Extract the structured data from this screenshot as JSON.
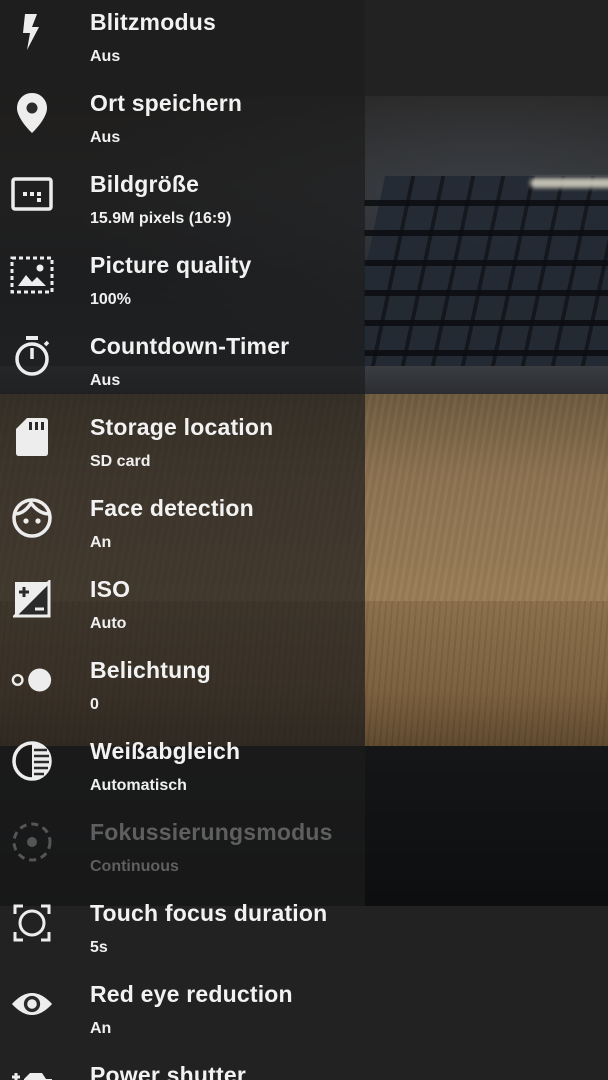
{
  "colors": {
    "panel_bg": "#222222",
    "text_primary": "#f2f2f2",
    "text_disabled": "#5f5f5f"
  },
  "settings": [
    {
      "title": "Blitzmodus",
      "value": "Aus",
      "icon": "flash-icon",
      "enabled": true
    },
    {
      "title": "Ort speichern",
      "value": "Aus",
      "icon": "location-pin-icon",
      "enabled": true
    },
    {
      "title": "Bildgröße",
      "value": "15.9M pixels (16:9)",
      "icon": "image-size-icon",
      "enabled": true
    },
    {
      "title": "Picture quality",
      "value": "100%",
      "icon": "picture-quality-icon",
      "enabled": true
    },
    {
      "title": "Countdown-Timer",
      "value": "Aus",
      "icon": "timer-icon",
      "enabled": true
    },
    {
      "title": "Storage location",
      "value": "SD card",
      "icon": "sd-card-icon",
      "enabled": true
    },
    {
      "title": "Face detection",
      "value": "An",
      "icon": "face-icon",
      "enabled": true
    },
    {
      "title": "ISO",
      "value": "Auto",
      "icon": "iso-icon",
      "enabled": true
    },
    {
      "title": "Belichtung",
      "value": "0",
      "icon": "exposure-icon",
      "enabled": true
    },
    {
      "title": "Weißabgleich",
      "value": "Automatisch",
      "icon": "white-balance-icon",
      "enabled": true
    },
    {
      "title": "Fokussierungsmodus",
      "value": "Continuous",
      "icon": "focus-mode-icon",
      "enabled": false
    },
    {
      "title": "Touch focus duration",
      "value": "5s",
      "icon": "touch-focus-icon",
      "enabled": true
    },
    {
      "title": "Red eye reduction",
      "value": "An",
      "icon": "eye-icon",
      "enabled": true
    },
    {
      "title": "Power shutter",
      "value": "",
      "icon": "power-shutter-icon",
      "enabled": true
    }
  ]
}
